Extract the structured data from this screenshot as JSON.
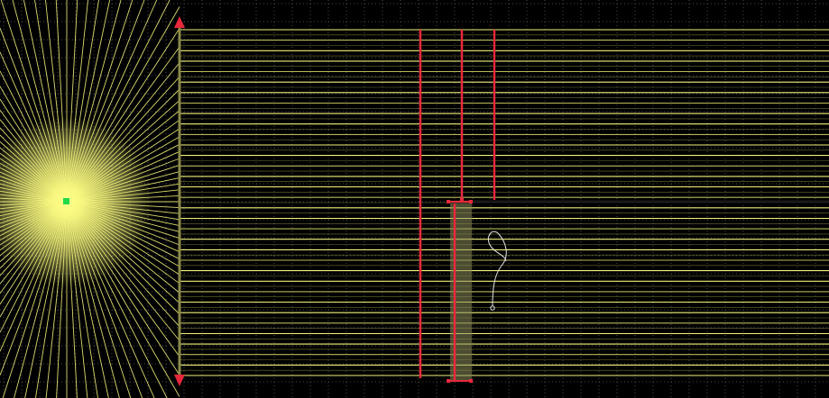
{
  "app": {
    "title": ""
  },
  "palette": {
    "background": "#000000",
    "grid": "#4a4a4a",
    "beam": "#f2f27a",
    "beam_dim": "#b8b85a",
    "element_red": "#e8283a",
    "source_green": "#22d94a",
    "curve_white": "#e6e6e6",
    "filled_region": "#8a8a5a"
  },
  "scene_elements": {
    "point_source": "point-source-icon",
    "aperture_left_arrow": "aperture-left-arrow-icon",
    "aperture_right_arrow": "aperture-right-arrow-icon",
    "sketch_curve": "squiggle-curve-icon"
  },
  "ray_bundle": {
    "parallel_rays": 34,
    "radial_rays": 120
  }
}
